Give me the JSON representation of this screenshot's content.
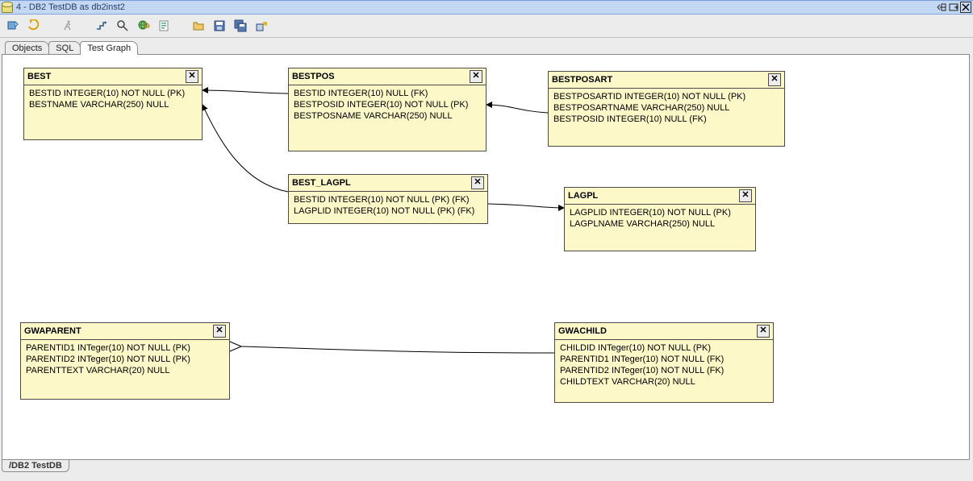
{
  "window": {
    "title": "4 - DB2 TestDB  as db2inst2"
  },
  "tabs": {
    "objects": "Objects",
    "sql": "SQL",
    "graph": "Test Graph"
  },
  "toolbar_icons": [
    "refresh-icon",
    "run-arrows-icon",
    "runner-icon",
    "step-icon",
    "zoom-icon",
    "globe-refresh-icon",
    "explain-icon",
    "open-icon",
    "save-icon",
    "save-all-icon",
    "export-icon"
  ],
  "entities": {
    "best": {
      "title": "BEST",
      "cols": [
        "BESTID  INTEGER(10) NOT NULL (PK)",
        "BESTNAME  VARCHAR(250) NULL"
      ]
    },
    "bestpos": {
      "title": "BESTPOS",
      "cols": [
        "BESTID  INTEGER(10) NULL (FK)",
        "BESTPOSID  INTEGER(10) NOT NULL (PK)",
        "BESTPOSNAME  VARCHAR(250) NULL"
      ]
    },
    "bestposart": {
      "title": "BESTPOSART",
      "cols": [
        "BESTPOSARTID  INTEGER(10) NOT NULL (PK)",
        "BESTPOSARTNAME  VARCHAR(250) NULL",
        "BESTPOSID  INTEGER(10) NULL (FK)"
      ]
    },
    "best_lagpl": {
      "title": "BEST_LAGPL",
      "cols": [
        "BESTID  INTEGER(10) NOT NULL (PK) (FK)",
        "LAGPLID  INTEGER(10) NOT NULL (PK) (FK)"
      ]
    },
    "lagpl": {
      "title": "LAGPL",
      "cols": [
        "LAGPLID  INTEGER(10) NOT NULL (PK)",
        "LAGPLNAME  VARCHAR(250) NULL"
      ]
    },
    "gwaparent": {
      "title": "GWAPARENT",
      "cols": [
        "PARENTID1  INTeger(10) NOT NULL (PK)",
        "PARENTID2  INTeger(10) NOT NULL (PK)",
        "PARENTTEXT  VARCHAR(20) NULL"
      ]
    },
    "gwachild": {
      "title": "GWACHILD",
      "cols": [
        "CHILDID  INTeger(10) NOT NULL (PK)",
        "PARENTID1  INTeger(10) NOT NULL (FK)",
        "PARENTID2  INTeger(10) NOT NULL (FK)",
        "CHILDTEXT  VARCHAR(20) NULL"
      ]
    }
  },
  "status": {
    "tab": "/DB2 TestDB"
  }
}
